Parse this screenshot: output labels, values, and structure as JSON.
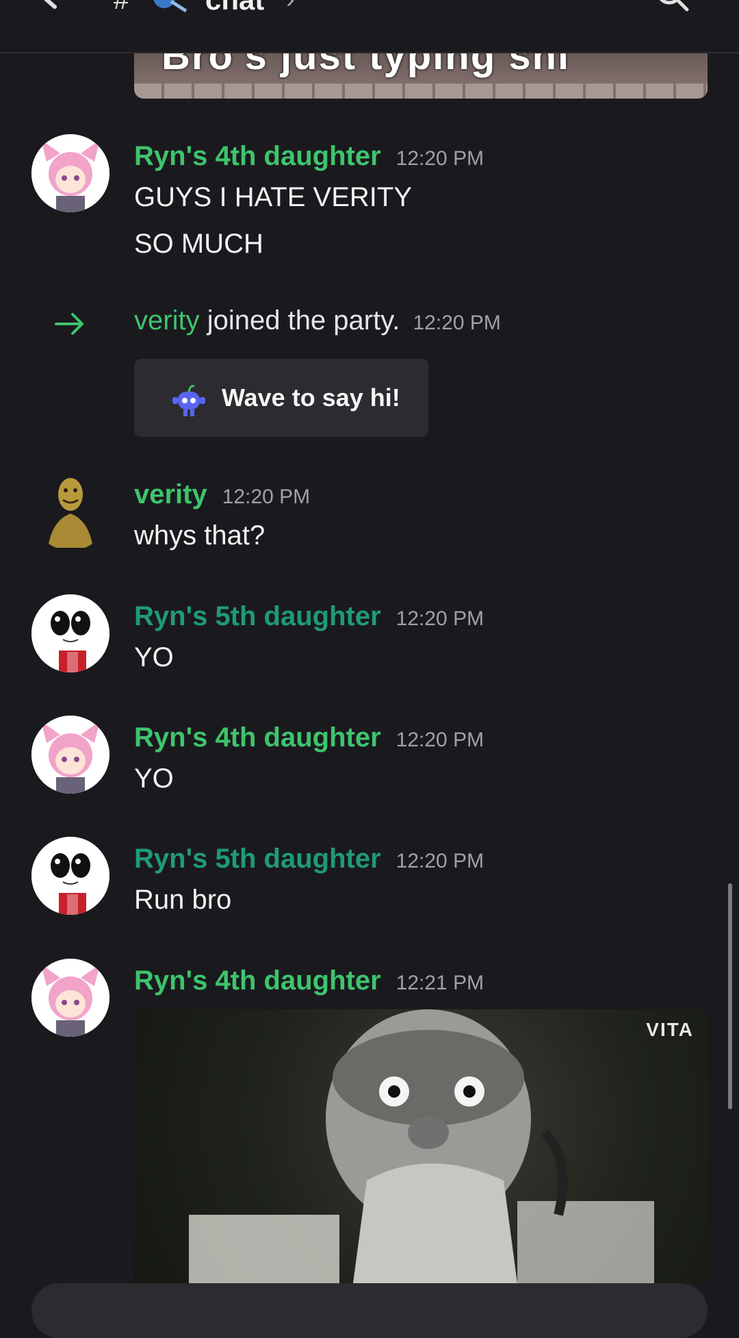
{
  "header": {
    "hash": "#",
    "channel_title": "chat",
    "chevron": "›",
    "back_icon": "back-arrow-icon",
    "search_icon": "search-icon"
  },
  "top_image": {
    "caption": "Bro's just typing shi"
  },
  "messages": [
    {
      "author": "Ryn's 4th daughter",
      "time": "12:20 PM",
      "lines": [
        "GUYS I HATE VERITY",
        "SO MUCH"
      ]
    },
    {
      "author": "verity",
      "time": "12:20 PM",
      "lines": [
        "whys that?"
      ]
    },
    {
      "author": "Ryn's 5th daughter",
      "time": "12:20 PM",
      "lines": [
        "YO"
      ]
    },
    {
      "author": "Ryn's 4th daughter",
      "time": "12:20 PM",
      "lines": [
        "YO"
      ]
    },
    {
      "author": "Ryn's 5th daughter",
      "time": "12:20 PM",
      "lines": [
        "Run bro"
      ]
    },
    {
      "author": "Ryn's 4th daughter",
      "time": "12:21 PM",
      "lines": []
    }
  ],
  "join_event": {
    "user": "verity",
    "text": "joined the party.",
    "time": "12:20 PM",
    "wave_button_label": "Wave to say hi!"
  },
  "media": {
    "watermark": "VITA"
  },
  "colors": {
    "background": "#1a1a1e",
    "username_green": "#3ec46d",
    "username_teal": "#1f9a7a"
  }
}
